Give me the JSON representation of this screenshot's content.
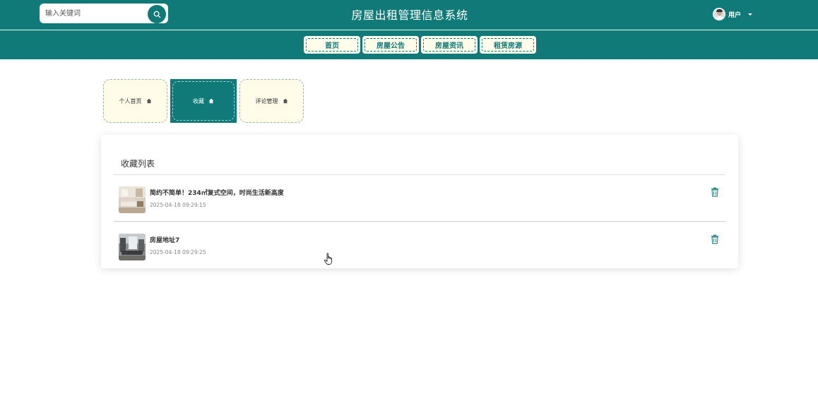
{
  "header": {
    "title": "房屋出租管理信息系统",
    "search": {
      "placeholder": "输入关键词",
      "icon": "search-icon"
    },
    "user": {
      "name": "用户",
      "icon": "avatar"
    }
  },
  "nav": [
    {
      "label": "首页"
    },
    {
      "label": "房屋公告"
    },
    {
      "label": "房屋资讯"
    },
    {
      "label": "租赁房源"
    }
  ],
  "tabs": [
    {
      "label": "个人首页",
      "icon": "home-icon",
      "active": false
    },
    {
      "label": "收藏",
      "icon": "home-icon",
      "active": true
    },
    {
      "label": "评论管理",
      "icon": "home-icon",
      "active": false
    }
  ],
  "favorites": {
    "title": "收藏列表",
    "items": [
      {
        "title": "简约不简单！234㎡复式空间，时尚生活新高度",
        "time": "2025-04-18 09:29:15",
        "icon": "trash-icon"
      },
      {
        "title": "房屋地址7",
        "time": "2025-04-18 09:29:25",
        "icon": "trash-icon"
      }
    ]
  },
  "colors": {
    "primary": "#0f7a78",
    "tab_bg": "#fffdea",
    "nav_bg": "#fffde9"
  }
}
